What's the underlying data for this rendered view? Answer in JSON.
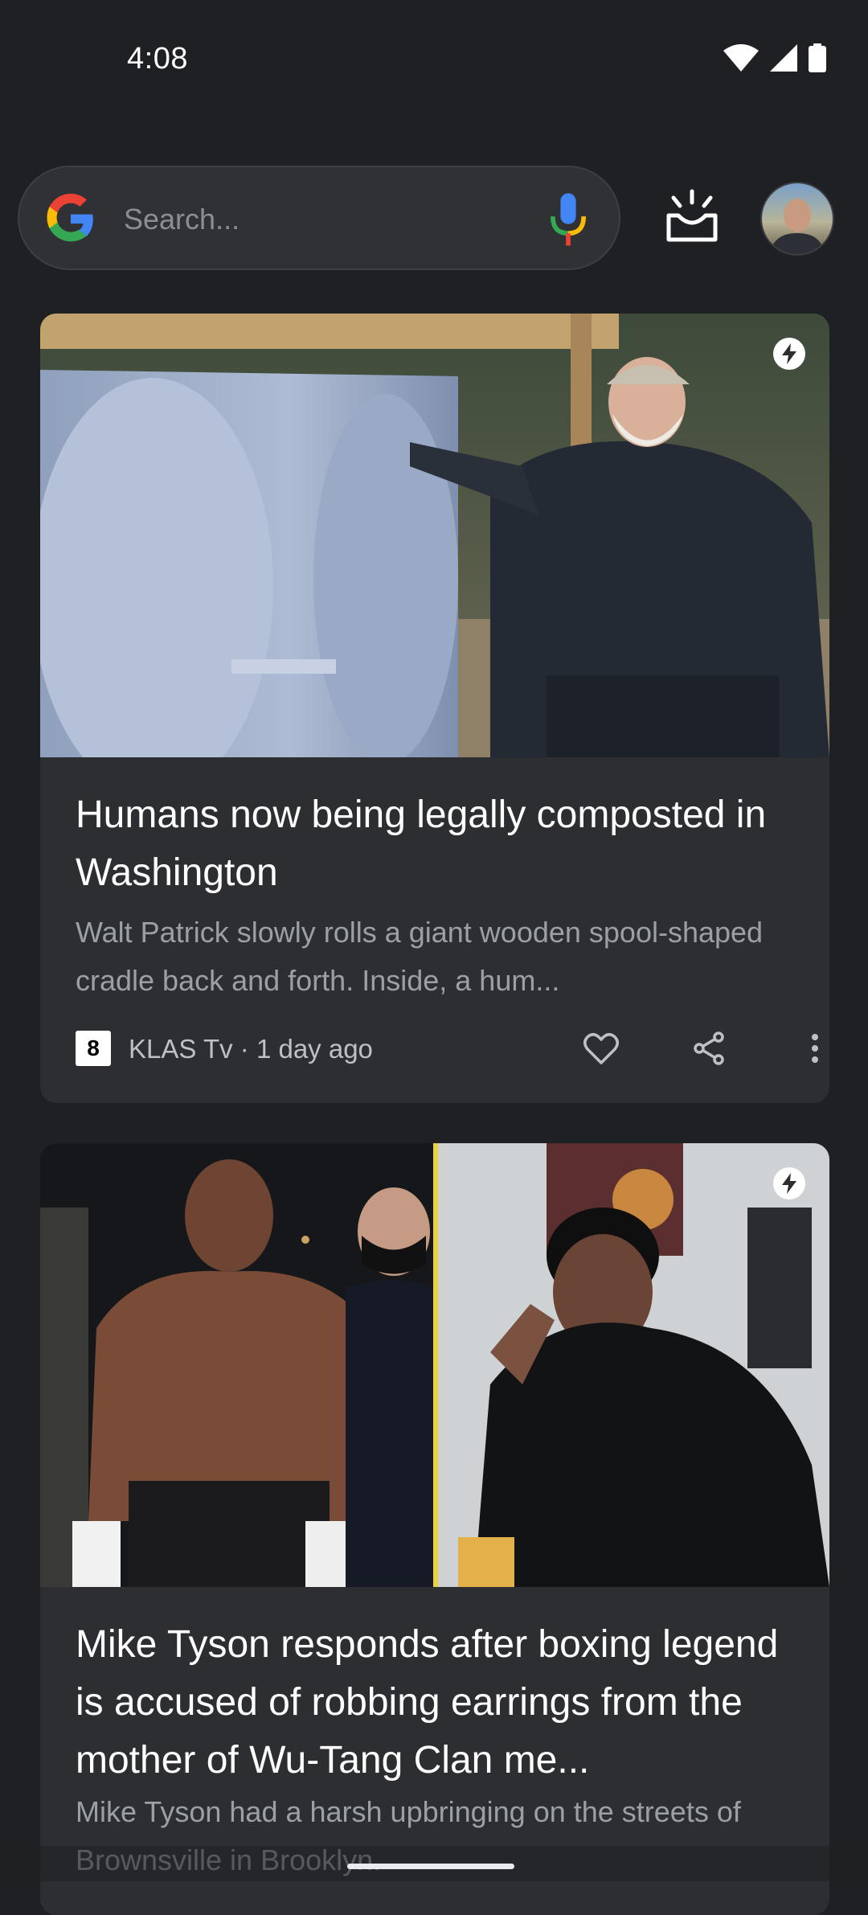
{
  "status_bar": {
    "time": "4:08",
    "icons": [
      "wifi-icon",
      "cellular-signal-icon",
      "battery-icon"
    ]
  },
  "search": {
    "placeholder": "Search...",
    "logo": "google-g-icon",
    "voice_icon": "microphone-icon"
  },
  "header_actions": {
    "discover_icon": "discover-updates-icon",
    "avatar": "account-avatar"
  },
  "feed": {
    "cards": [
      {
        "title": "Humans now being legally composted in Washington",
        "snippet": "Walt Patrick slowly rolls a giant wooden spool-shaped cradle back and forth. Inside, a hum...",
        "source_logo_text": "8",
        "source": "KLAS Tv · 1 day ago",
        "badge": "amp-lightning-icon"
      },
      {
        "title": "Mike Tyson responds after boxing legend is accused of robbing earrings from the mother of Wu-Tang Clan me...",
        "snippet": "Mike Tyson had a harsh upbringing on the streets of Brownsville in Brooklyn.",
        "badge": "amp-lightning-icon"
      }
    ]
  },
  "colors": {
    "background": "#1f2023",
    "card": "#2d2e31",
    "search_bar": "#303134",
    "secondary_text": "#9aa0a6",
    "google_blue": "#4285F4",
    "google_red": "#EA4335",
    "google_yellow": "#FBBC05",
    "google_green": "#34A853"
  }
}
